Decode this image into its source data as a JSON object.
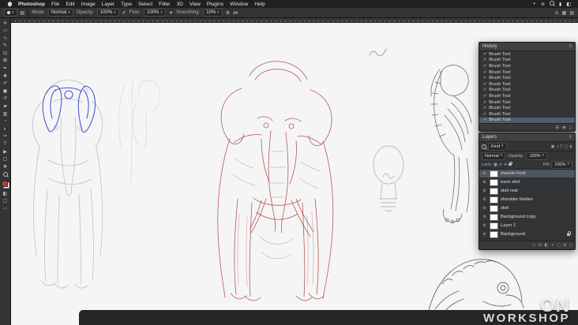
{
  "ui": {
    "caret": "▾",
    "panel_menu": "≡",
    "eye": "⊙",
    "ellipsis": "⋯"
  },
  "menu_bar": {
    "app_name": "Photoshop",
    "items": [
      "File",
      "Edit",
      "Image",
      "Layer",
      "Type",
      "Select",
      "Filter",
      "3D",
      "View",
      "Plugins",
      "Window",
      "Help"
    ],
    "status_icons": [
      {
        "name": "control-strip-icon",
        "glyph": "◐"
      },
      {
        "name": "wifi-icon",
        "glyph": "≋"
      },
      {
        "name": "battery-icon",
        "glyph": "▮"
      },
      {
        "name": "control-center-icon",
        "glyph": "◧"
      }
    ]
  },
  "options_bar": {
    "mode_label": "Mode:",
    "mode_value": "Normal",
    "opacity_label": "Opacity:",
    "opacity_value": "100%",
    "flow_label": "Flow:",
    "flow_value": "100%",
    "smoothing_label": "Smoothing:",
    "smoothing_value": "10%",
    "icons": {
      "brush_settings": "▤",
      "pressure_opacity": "✐",
      "airbrush": "✦",
      "gear": "⚙",
      "symmetry": "⋈",
      "capture": "⊙",
      "workspace": "▦",
      "arrange": "▤"
    }
  },
  "toolbar": {
    "foreground_color": "#c13a32",
    "background_color": "#ffffff",
    "tools": [
      {
        "name": "move-tool",
        "glyph": "✛"
      },
      {
        "name": "marquee-tool",
        "glyph": "▭"
      },
      {
        "name": "lasso-tool",
        "glyph": "∿"
      },
      {
        "name": "quick-selection-tool",
        "glyph": "✎"
      },
      {
        "name": "crop-tool",
        "glyph": "⊡"
      },
      {
        "name": "frame-tool",
        "glyph": "⊠"
      },
      {
        "name": "eyedropper-tool",
        "glyph": "✒"
      },
      {
        "name": "healing-brush-tool",
        "glyph": "✚"
      },
      {
        "name": "brush-tool",
        "glyph": "✐"
      },
      {
        "name": "clone-stamp-tool",
        "glyph": "▣"
      },
      {
        "name": "history-brush-tool",
        "glyph": "↺"
      },
      {
        "name": "eraser-tool",
        "glyph": "▰"
      },
      {
        "name": "gradient-tool",
        "glyph": "▥"
      },
      {
        "name": "blur-tool",
        "glyph": "◔"
      },
      {
        "name": "dodge-tool",
        "glyph": "◐"
      },
      {
        "name": "pen-tool",
        "glyph": "✑"
      },
      {
        "name": "type-tool",
        "glyph": "T"
      },
      {
        "name": "path-selection-tool",
        "glyph": "▶"
      },
      {
        "name": "shape-tool",
        "glyph": "▢"
      },
      {
        "name": "hand-tool",
        "glyph": "✥"
      }
    ],
    "extra_icons": [
      {
        "name": "quick-mask-icon",
        "glyph": "◧"
      },
      {
        "name": "screen-mode-icon",
        "glyph": "▢"
      },
      {
        "name": "more-tools-icon",
        "glyph": "⋯"
      }
    ]
  },
  "history_panel": {
    "title": "History",
    "entry_icon": "✐",
    "entries": [
      "Brush Tool",
      "Brush Tool",
      "Brush Tool",
      "Brush Tool",
      "Brush Tool",
      "Brush Tool",
      "Brush Tool",
      "Brush Tool",
      "Brush Tool",
      "Brush Tool",
      "Brush Tool",
      "Brush Tool"
    ],
    "footer_icons": [
      {
        "name": "new-doc-from-state-icon",
        "glyph": "⊞"
      },
      {
        "name": "new-snapshot-icon",
        "glyph": "◉"
      },
      {
        "name": "delete-state-icon",
        "glyph": "▯"
      }
    ]
  },
  "layers_panel": {
    "title": "Layers",
    "kind_label": "Kind",
    "filter_icons": [
      {
        "name": "filter-pixel-icon",
        "glyph": "▣"
      },
      {
        "name": "filter-adjustment-icon",
        "glyph": "◑"
      },
      {
        "name": "filter-type-icon",
        "glyph": "T"
      },
      {
        "name": "filter-shape-icon",
        "glyph": "▢"
      },
      {
        "name": "filter-smart-icon",
        "glyph": "◈"
      }
    ],
    "blend_mode": "Normal",
    "opacity_label": "Opacity:",
    "opacity_value": "100%",
    "lock_label": "Lock:",
    "lock_icons": [
      {
        "name": "lock-transparency-icon",
        "glyph": "▦"
      },
      {
        "name": "lock-paint-icon",
        "glyph": "✐"
      },
      {
        "name": "lock-position-icon",
        "glyph": "✛"
      }
    ],
    "fill_label": "Fill:",
    "fill_value": "100%",
    "layers": [
      {
        "name": "muscle front",
        "selected": true,
        "locked": false
      },
      {
        "name": "back skel",
        "selected": false,
        "locked": false
      },
      {
        "name": "skel rear",
        "selected": false,
        "locked": false
      },
      {
        "name": "shoulder blades",
        "selected": false,
        "locked": false
      },
      {
        "name": "skel",
        "selected": false,
        "locked": false
      },
      {
        "name": "Background copy",
        "selected": false,
        "locked": false
      },
      {
        "name": "Layer 1",
        "selected": false,
        "locked": false
      },
      {
        "name": "Background",
        "selected": false,
        "locked": true
      }
    ],
    "footer_icons": [
      {
        "name": "link-layers-icon",
        "glyph": "∞"
      },
      {
        "name": "layer-effects-icon",
        "glyph": "fx"
      },
      {
        "name": "layer-mask-icon",
        "glyph": "◧"
      },
      {
        "name": "adjustment-layer-icon",
        "glyph": "◑"
      },
      {
        "name": "layer-group-icon",
        "glyph": "▢"
      },
      {
        "name": "new-layer-icon",
        "glyph": "⊞"
      },
      {
        "name": "delete-layer-icon",
        "glyph": "▯"
      }
    ]
  },
  "watermark": {
    "line1": "ON",
    "line2": "WORKSHOP"
  },
  "artwork_colors": {
    "pencil_gray": "#989ca3",
    "muscle_red": "#a83232",
    "overlay_blue": "#2e3ec4",
    "bone_dark": "#565b61"
  }
}
